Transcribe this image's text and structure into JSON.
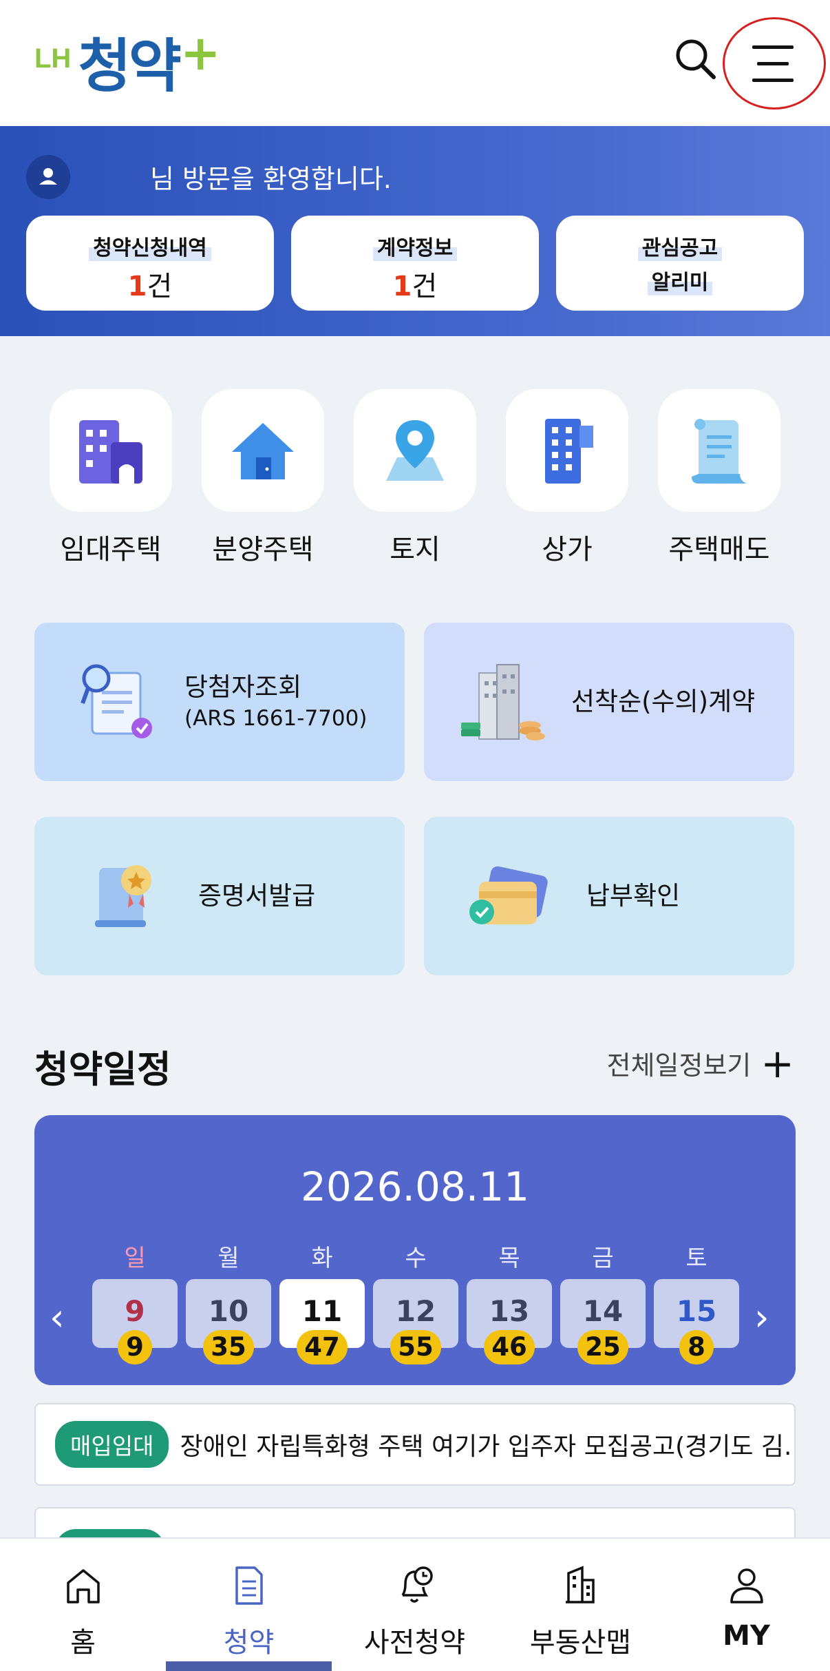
{
  "header": {
    "logo_lh": "LH",
    "logo_main": "청약",
    "logo_plus": "+",
    "search_icon": "search-icon",
    "menu_icon": "hamburger-menu-icon",
    "menu_highlight_color": "#d4201f"
  },
  "banner": {
    "welcome": "님 방문을 환영합니다.",
    "cards": [
      {
        "label": "청약신청내역",
        "count": "1",
        "unit": "건"
      },
      {
        "label": "계약정보",
        "count": "1",
        "unit": "건"
      },
      {
        "label": "관심공고",
        "label2": "알리미"
      }
    ]
  },
  "categories": [
    {
      "label": "임대주택",
      "icon": "building-icon"
    },
    {
      "label": "분양주택",
      "icon": "house-icon"
    },
    {
      "label": "토지",
      "icon": "map-pin-icon"
    },
    {
      "label": "상가",
      "icon": "office-building-icon"
    },
    {
      "label": "주택매도",
      "icon": "document-scroll-icon"
    }
  ],
  "services": [
    {
      "label": "당첨자조회",
      "sub": "(ARS 1661-7700)",
      "icon": "search-document-icon"
    },
    {
      "label": "선착순(수의)계약",
      "icon": "apartment-coins-icon"
    },
    {
      "label": "증명서발급",
      "icon": "certificate-icon"
    },
    {
      "label": "납부확인",
      "icon": "payment-card-icon"
    }
  ],
  "schedule": {
    "title": "청약일정",
    "more": "전체일정보기",
    "date": "2026.08.11",
    "days": [
      {
        "name": "일",
        "day": "9",
        "count": "9"
      },
      {
        "name": "월",
        "day": "10",
        "count": "35"
      },
      {
        "name": "화",
        "day": "11",
        "count": "47"
      },
      {
        "name": "수",
        "day": "12",
        "count": "55"
      },
      {
        "name": "목",
        "day": "13",
        "count": "46"
      },
      {
        "name": "금",
        "day": "14",
        "count": "25"
      },
      {
        "name": "토",
        "day": "15",
        "count": "8"
      }
    ],
    "prev": "‹",
    "next": "›"
  },
  "notices": [
    {
      "tag": "매입임대",
      "text": "장애인 자립특화형 주택 여기가 입주자 모집공고(경기도 김..."
    }
  ],
  "nav": [
    {
      "label": "홈",
      "icon": "home-icon"
    },
    {
      "label": "청약",
      "icon": "document-icon"
    },
    {
      "label": "사전청약",
      "icon": "bell-clock-icon"
    },
    {
      "label": "부동산맵",
      "icon": "building-map-icon"
    },
    {
      "label": "MY",
      "icon": "user-icon"
    }
  ]
}
